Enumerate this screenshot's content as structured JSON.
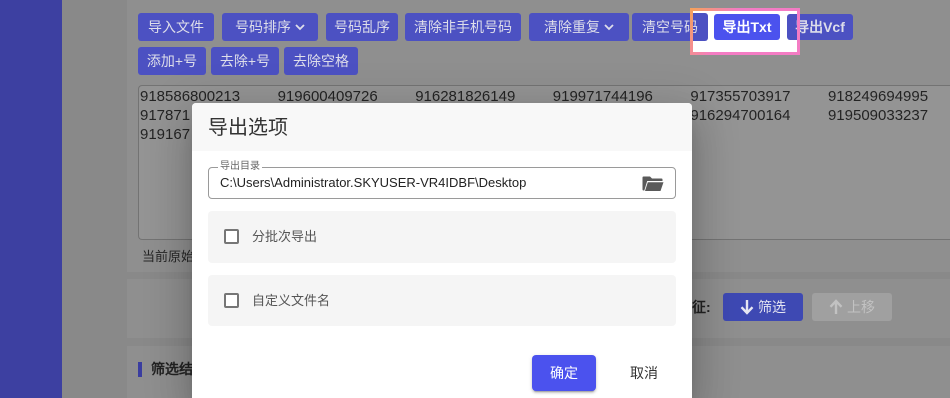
{
  "colors": {
    "sidebar": "#3d40a1",
    "accent": "#4b52ee",
    "highlight_border": "#f47cc4"
  },
  "toolbar": {
    "buttons": [
      {
        "label": "导入文件"
      },
      {
        "label": "号码排序",
        "icon": "chevron-down-icon"
      },
      {
        "label": "号码乱序"
      },
      {
        "label": "清除非手机号码"
      },
      {
        "label": "清除重复",
        "icon": "chevron-down-icon"
      },
      {
        "label": "清空号码"
      },
      {
        "label": "导出Txt",
        "highlighted": true
      },
      {
        "label": "导出Vcf"
      },
      {
        "label": "添加+号"
      },
      {
        "label": "去除+号"
      },
      {
        "label": "去除空格"
      }
    ]
  },
  "numbers_textarea": {
    "rows": [
      [
        "918586800213",
        "919600409726",
        "916281826149",
        "919971744196",
        "917355703917",
        "918249694995"
      ],
      [
        "917871",
        null,
        null,
        null,
        "916294700164",
        "919509033237"
      ],
      [
        "919167"
      ]
    ]
  },
  "status": {
    "text": "当前原始"
  },
  "filter": {
    "label": "征:",
    "filter_button": {
      "label": "筛选",
      "icon": "arrow-down-icon"
    },
    "move_up_button": {
      "label": "上移",
      "icon": "arrow-up-icon",
      "disabled": true
    }
  },
  "results": {
    "title": "筛选结"
  },
  "dialog": {
    "title": "导出选项",
    "directory_field": {
      "label": "导出目录",
      "value": "C:\\Users\\Administrator.SKYUSER-VR4IDBF\\Desktop",
      "icon": "folder-icon"
    },
    "options": [
      {
        "label": "分批次导出",
        "checked": false
      },
      {
        "label": "自定义文件名",
        "checked": false
      }
    ],
    "confirm_button": "确定",
    "cancel_button": "取消"
  }
}
